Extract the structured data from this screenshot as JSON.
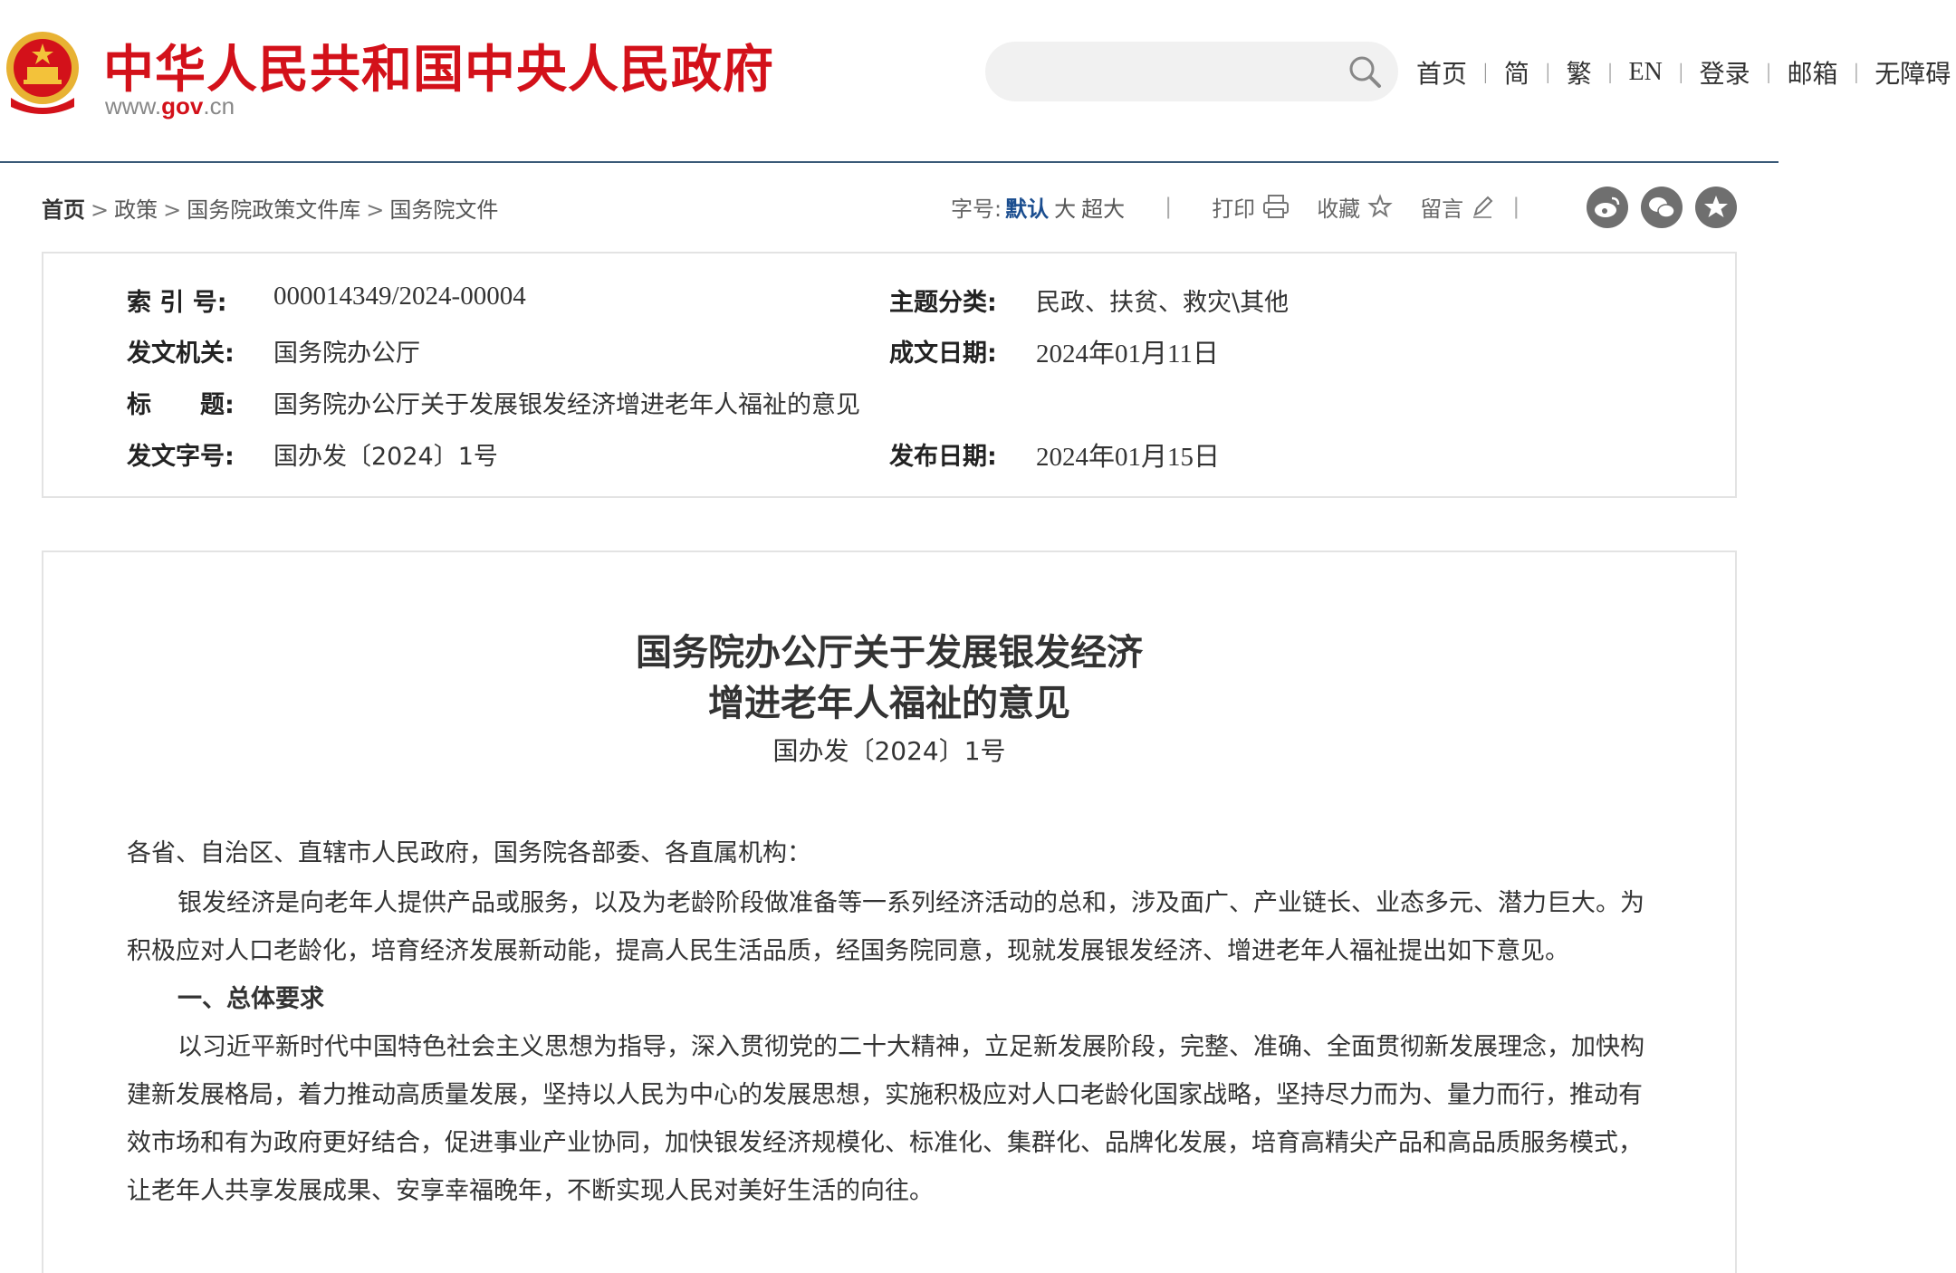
{
  "header": {
    "site_name": "中华人民共和国中央人民政府",
    "site_url_prefix": "www.",
    "site_url_brand": "gov",
    "site_url_suffix": ".cn",
    "search_placeholder": "",
    "nav": [
      "首页",
      "简",
      "繁",
      "EN",
      "登录",
      "邮箱",
      "无障碍"
    ],
    "brand_color": "#d3111a"
  },
  "breadcrumb": {
    "items": [
      "首页",
      "政策",
      "国务院政策文件库",
      "国务院文件"
    ],
    "separator": ">"
  },
  "tools": {
    "font_size_label": "字号:",
    "font_sizes": [
      "默认",
      "大",
      "超大"
    ],
    "print": "打印",
    "favorite": "收藏",
    "comment": "留言",
    "share_icons": [
      "weibo-icon",
      "wechat-icon",
      "star-share-icon"
    ]
  },
  "info": {
    "index_label": "索 引 号:",
    "index_value": "000014349/2024-00004",
    "topic_label": "主题分类:",
    "topic_value": "民政、扶贫、救灾\\其他",
    "issuer_label": "发文机关:",
    "issuer_value": "国务院办公厅",
    "created_label": "成文日期:",
    "created_value": "2024年01月11日",
    "title_label": "标　　题:",
    "title_value": "国务院办公厅关于发展银发经济增进老年人福祉的意见",
    "docno_label": "发文字号:",
    "docno_value": "国办发〔2024〕1号",
    "published_label": "发布日期:",
    "published_value": "2024年01月15日"
  },
  "document": {
    "title_line1": "国务院办公厅关于发展银发经济",
    "title_line2": "增进老年人福祉的意见",
    "doc_number": "国办发〔2024〕1号",
    "salutation": "各省、自治区、直辖市人民政府，国务院各部委、各直属机构：",
    "para1": "银发经济是向老年人提供产品或服务，以及为老龄阶段做准备等一系列经济活动的总和，涉及面广、产业链长、业态多元、潜力巨大。为积极应对人口老龄化，培育经济发展新动能，提高人民生活品质，经国务院同意，现就发展银发经济、增进老年人福祉提出如下意见。",
    "heading1": "一、总体要求",
    "para2": "以习近平新时代中国特色社会主义思想为指导，深入贯彻党的二十大精神，立足新发展阶段，完整、准确、全面贯彻新发展理念，加快构建新发展格局，着力推动高质量发展，坚持以人民为中心的发展思想，实施积极应对人口老龄化国家战略，坚持尽力而为、量力而行，推动有效市场和有为政府更好结合，促进事业产业协同，加快银发经济规模化、标准化、集群化、品牌化发展，培育高精尖产品和高品质服务模式，让老年人共享发展成果、安享幸福晚年，不断实现人民对美好生活的向往。"
  }
}
